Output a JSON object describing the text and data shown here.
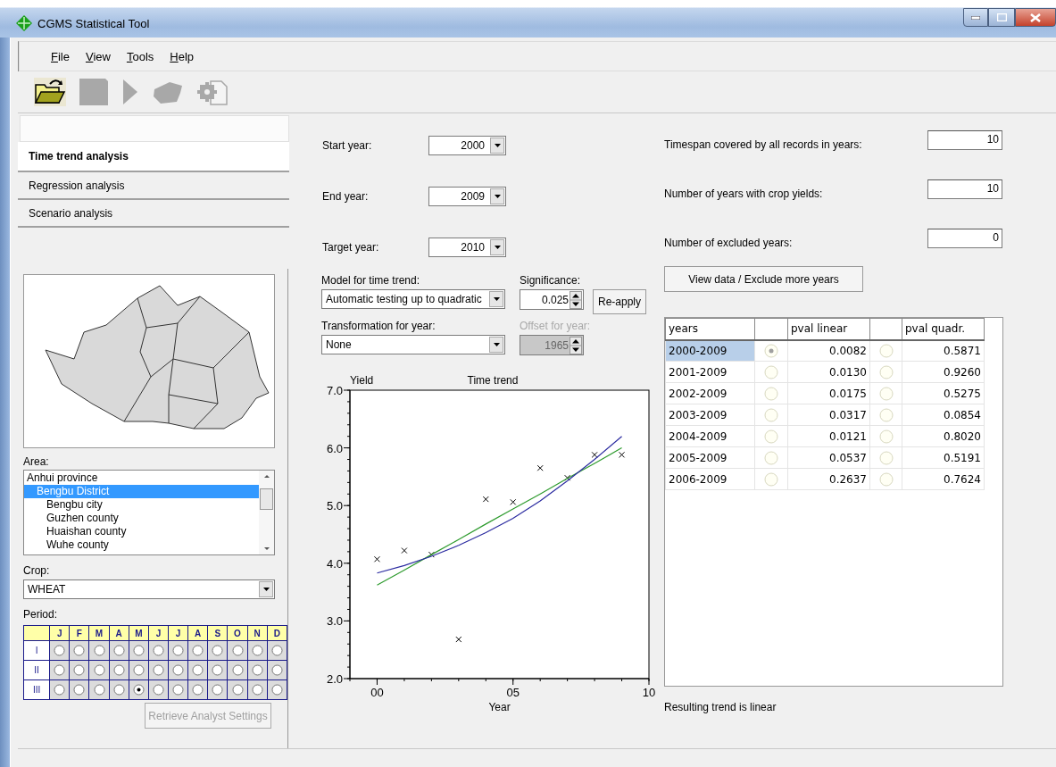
{
  "window": {
    "title": "CGMS Statistical Tool"
  },
  "menu": [
    "File",
    "View",
    "Tools",
    "Help"
  ],
  "toolbar": [
    {
      "kind": "open",
      "disabled": false
    },
    {
      "kind": "save",
      "disabled": true
    },
    {
      "kind": "run",
      "disabled": true
    },
    {
      "kind": "shape",
      "disabled": true
    },
    {
      "kind": "settings",
      "disabled": true
    }
  ],
  "sidebar": {
    "tabs": [
      {
        "label": "Time trend analysis",
        "selected": true
      },
      {
        "label": "Regression analysis",
        "selected": false
      },
      {
        "label": "Scenario analysis",
        "selected": false
      }
    ],
    "area": {
      "label": "Area:",
      "items": [
        {
          "label": "Anhui province",
          "selected": false,
          "children": [
            {
              "label": "Bengbu District",
              "selected": true,
              "children": [
                {
                  "label": "Bengbu city",
                  "selected": false
                },
                {
                  "label": "Guzhen county",
                  "selected": false
                },
                {
                  "label": "Huaishan county",
                  "selected": false
                },
                {
                  "label": "Wuhe county",
                  "selected": false
                }
              ]
            }
          ]
        }
      ]
    },
    "crop": {
      "label": "Crop:",
      "value": "WHEAT"
    },
    "period": {
      "label": "Period:",
      "months": [
        "J",
        "F",
        "M",
        "A",
        "M",
        "J",
        "J",
        "A",
        "S",
        "O",
        "N",
        "D"
      ],
      "rows": [
        {
          "label": "I",
          "cells": [
            {
              "selected": false
            },
            {
              "selected": false
            },
            {
              "selected": false
            },
            {
              "selected": false
            },
            {
              "selected": false
            },
            {
              "selected": false
            },
            {
              "selected": false
            },
            {
              "selected": false
            },
            {
              "selected": false
            },
            {
              "selected": false
            },
            {
              "selected": false
            },
            {
              "selected": false
            }
          ]
        },
        {
          "label": "II",
          "cells": [
            {
              "selected": false
            },
            {
              "selected": false
            },
            {
              "selected": false
            },
            {
              "selected": false
            },
            {
              "selected": false
            },
            {
              "selected": false
            },
            {
              "selected": false
            },
            {
              "selected": false
            },
            {
              "selected": false
            },
            {
              "selected": false
            },
            {
              "selected": false
            },
            {
              "selected": false
            }
          ]
        },
        {
          "label": "III",
          "cells": [
            {
              "selected": false
            },
            {
              "selected": false
            },
            {
              "selected": false
            },
            {
              "selected": false
            },
            {
              "selected": true
            },
            {
              "selected": false
            },
            {
              "selected": false
            },
            {
              "selected": false
            },
            {
              "selected": false
            },
            {
              "selected": false
            },
            {
              "selected": false
            },
            {
              "selected": false
            }
          ]
        }
      ]
    },
    "retrieve_button": {
      "label": "Retrieve Analyst Settings",
      "disabled": true
    }
  },
  "time_trend": {
    "start_year": {
      "label": "Start year:",
      "value": "2000"
    },
    "end_year": {
      "label": "End year:",
      "value": "2009"
    },
    "target_year": {
      "label": "Target year:",
      "value": "2010"
    },
    "model": {
      "label": "Model for time trend:",
      "value": "Automatic testing up to quadratic"
    },
    "significance": {
      "label": "Significance:",
      "value": "0.025"
    },
    "reapply_button": "Re-apply",
    "transformation": {
      "label": "Transformation for year:",
      "value": "None"
    },
    "offset": {
      "label": "Offset for year:",
      "value": "1965",
      "disabled": true
    },
    "chart_data": {
      "type": "scatter",
      "title": "Time trend",
      "xlabel": "Year",
      "ylabel": "Yield",
      "x": [
        0,
        1,
        2,
        3,
        4,
        5,
        6,
        7,
        8,
        9
      ],
      "series": [
        {
          "marker": "x",
          "color": "#000000",
          "values": [
            4.07,
            4.22,
            4.15,
            2.68,
            5.11,
            5.06,
            5.65,
            5.48,
            5.88,
            5.88
          ]
        },
        {
          "type": "line",
          "color": "#2e9b2e",
          "values": [
            3.62,
            3.88,
            4.15,
            4.41,
            4.68,
            4.94,
            5.2,
            5.47,
            5.73,
            6.0
          ]
        },
        {
          "type": "line",
          "color": "#2b2ba0",
          "values": [
            3.83,
            3.96,
            4.12,
            4.31,
            4.53,
            4.78,
            5.08,
            5.43,
            5.8,
            6.2
          ]
        }
      ],
      "xlim": [
        -1,
        10
      ],
      "ylim": [
        2,
        7
      ],
      "xticks": [
        {
          "value": 0,
          "label": "00"
        },
        {
          "value": 5,
          "label": "05"
        },
        {
          "value": 10,
          "label": "10"
        }
      ],
      "yticks": [
        {
          "value": 2,
          "label": "2.0"
        },
        {
          "value": 3,
          "label": "3.0"
        },
        {
          "value": 4,
          "label": "4.0"
        },
        {
          "value": 5,
          "label": "5.0"
        },
        {
          "value": 6,
          "label": "6.0"
        },
        {
          "value": 7,
          "label": "7.0"
        }
      ]
    }
  },
  "statistics": {
    "fields": [
      {
        "label": "Timespan covered by all records in years:",
        "value": "10"
      },
      {
        "label": "Number of years with crop yields:",
        "value": "10"
      },
      {
        "label": "Number of excluded years:",
        "value": "0"
      }
    ],
    "view_button": "View data / Exclude more years",
    "table": {
      "columns": [
        "years",
        "pval linear",
        "pval quadr."
      ],
      "rows": [
        {
          "years": "2000-2009",
          "selected": true,
          "linear_chosen": true,
          "pval_linear": "0.0082",
          "quadr_chosen": false,
          "pval_quadr": "0.5871"
        },
        {
          "years": "2001-2009",
          "selected": false,
          "linear_chosen": false,
          "pval_linear": "0.0130",
          "quadr_chosen": false,
          "pval_quadr": "0.9260"
        },
        {
          "years": "2002-2009",
          "selected": false,
          "linear_chosen": false,
          "pval_linear": "0.0175",
          "quadr_chosen": false,
          "pval_quadr": "0.5275"
        },
        {
          "years": "2003-2009",
          "selected": false,
          "linear_chosen": false,
          "pval_linear": "0.0317",
          "quadr_chosen": false,
          "pval_quadr": "0.0854"
        },
        {
          "years": "2004-2009",
          "selected": false,
          "linear_chosen": false,
          "pval_linear": "0.0121",
          "quadr_chosen": false,
          "pval_quadr": "0.8020"
        },
        {
          "years": "2005-2009",
          "selected": false,
          "linear_chosen": false,
          "pval_linear": "0.0537",
          "quadr_chosen": false,
          "pval_quadr": "0.5191"
        },
        {
          "years": "2006-2009",
          "selected": false,
          "linear_chosen": false,
          "pval_linear": "0.2637",
          "quadr_chosen": false,
          "pval_quadr": "0.7624"
        }
      ]
    },
    "result": "Resulting trend is linear"
  }
}
